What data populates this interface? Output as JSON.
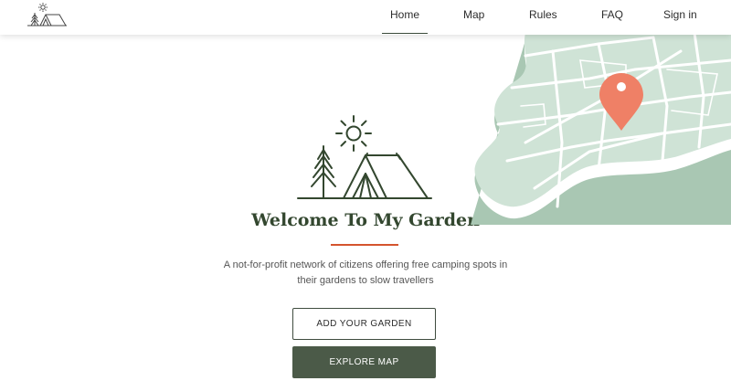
{
  "nav": {
    "items": [
      {
        "label": "Home",
        "active": true
      },
      {
        "label": "Map",
        "active": false
      },
      {
        "label": "Rules",
        "active": false
      },
      {
        "label": "FAQ",
        "active": false
      },
      {
        "label": "Sign in",
        "active": false
      }
    ]
  },
  "hero": {
    "title": "Welcome To My Garden",
    "subtitle_line1": "A not-for-profit network of citizens offering free camping spots in",
    "subtitle_line2": "their gardens to slow travellers"
  },
  "buttons": {
    "add_garden": "ADD YOUR GARDEN",
    "explore_map": "EXPLORE MAP"
  },
  "icons": [
    "logo-tent-icon",
    "map-illustration",
    "map-pin-icon",
    "sun-icon",
    "tree-icon",
    "tent-icon"
  ],
  "colors": {
    "primary_green": "#33472f",
    "button_green": "#4b5a48",
    "accent_rule": "#d4542e",
    "map_land": "#cfe3d6",
    "map_shadow": "#a9c7b3",
    "pin": "#ef8066"
  }
}
